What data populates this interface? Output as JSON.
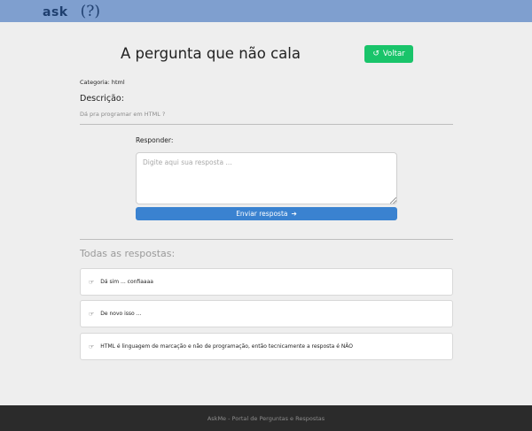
{
  "header": {
    "logo_text": "ask",
    "logo_mark": "(?)",
    "color": "#7f9fcf"
  },
  "question": {
    "title": "A pergunta que não cala",
    "back_label": "Voltar",
    "back_icon": "undo-icon",
    "category": "Categoria: html",
    "description_heading": "Descrição:",
    "description_text": "Dá pra programar em HTML ?"
  },
  "reply": {
    "label": "Responder:",
    "placeholder": "Digite aqui sua resposta ...",
    "value": "",
    "submit_label": "Enviar resposta",
    "submit_icon": "arrow-right-icon"
  },
  "answers": {
    "heading": "Todas as respostas:",
    "items": [
      {
        "icon": "thumbs-up-icon",
        "text": "Dá sim ... confiaaaa"
      },
      {
        "icon": "thumbs-up-icon",
        "text": "De novo isso ..."
      },
      {
        "icon": "thumbs-up-icon",
        "text": "HTML é linguagem de marcação e não de programação, então tecnicamente a resposta é NÃO"
      }
    ]
  },
  "footer": {
    "text": "AskMe - Portal de Perguntas e Respostas"
  },
  "colors": {
    "accent_green": "#19c46a",
    "accent_blue": "#3a82d0",
    "background": "#eeeeee",
    "footer_bg": "#2b2b2b"
  }
}
